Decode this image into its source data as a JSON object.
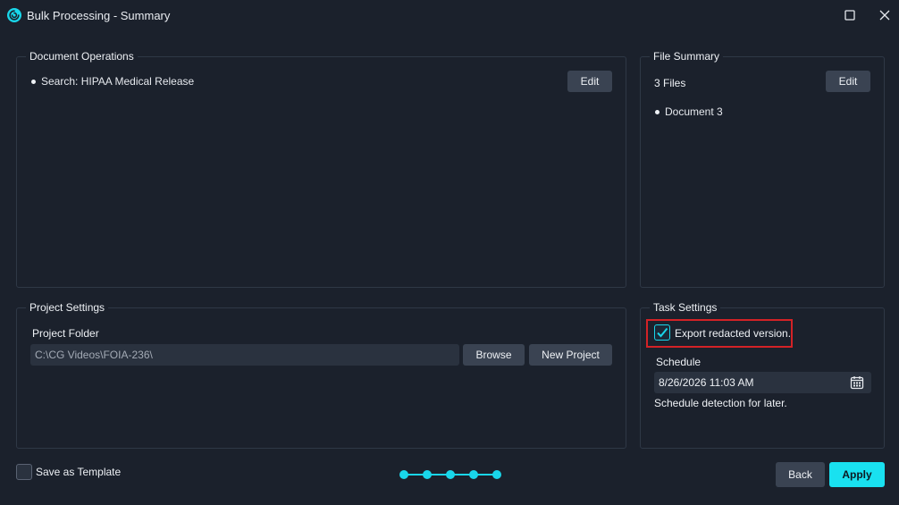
{
  "window": {
    "title": "Bulk Processing - Summary",
    "icons": {
      "app": "app-logo-icon",
      "maximize": "maximize-icon",
      "close": "close-icon"
    }
  },
  "document_operations": {
    "label": "Document Operations",
    "edit_label": "Edit",
    "items": [
      "Search: HIPAA Medical Release"
    ]
  },
  "file_summary": {
    "label": "File Summary",
    "count_text": "3 Files",
    "edit_label": "Edit",
    "items": [
      "Document 3"
    ]
  },
  "project_settings": {
    "label": "Project Settings",
    "folder_label": "Project Folder",
    "folder_value": "C:\\CG Videos\\FOIA-236\\",
    "browse_label": "Browse",
    "new_project_label": "New Project"
  },
  "task_settings": {
    "label": "Task Settings",
    "export_label": "Export redacted version.",
    "export_checked": true,
    "schedule_label": "Schedule",
    "schedule_value": "8/26/2026 11:03 AM",
    "schedule_note": "Schedule detection for later.",
    "calendar_icon": "calendar-icon"
  },
  "footer": {
    "save_template_label": "Save as Template",
    "save_template_checked": false,
    "back_label": "Back",
    "apply_label": "Apply",
    "steps_total": 5,
    "steps_completed": 5
  },
  "colors": {
    "background": "#1b212c",
    "accent": "#19d6ea",
    "button": "#3a4352",
    "highlight": "#d32226"
  }
}
